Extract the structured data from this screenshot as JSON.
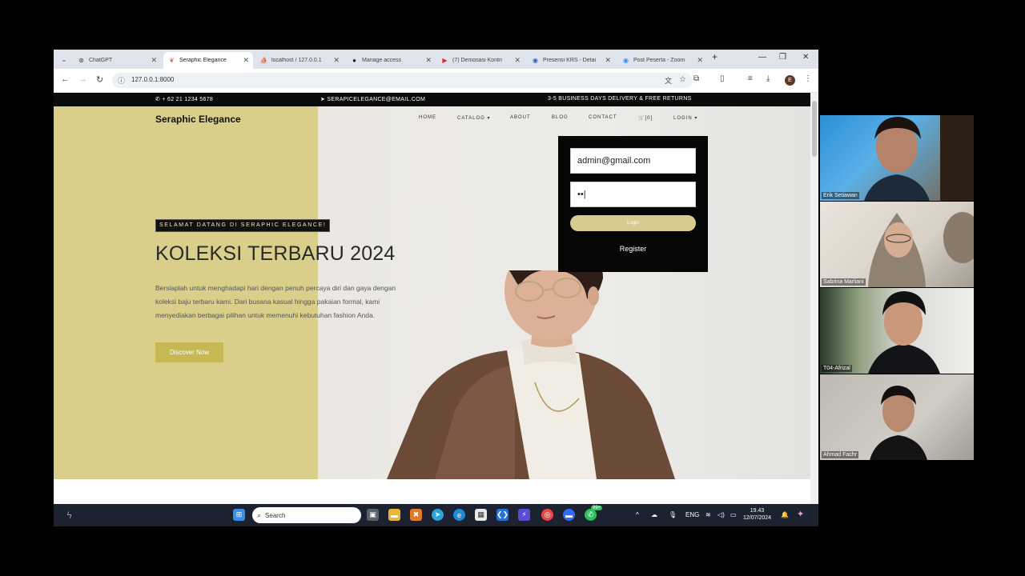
{
  "browser": {
    "tabs": [
      {
        "label": "ChatGPT",
        "icon": "chatgpt-icon",
        "close": "✕"
      },
      {
        "label": "Seraphic Elegance",
        "icon": "site-icon",
        "close": "✕",
        "active": true
      },
      {
        "label": "localhost / 127.0.0.1",
        "icon": "phpmyadmin-icon",
        "close": "✕"
      },
      {
        "label": "Manage access",
        "icon": "github-icon",
        "close": "✕"
      },
      {
        "label": "(7) Demosasi Kontri",
        "icon": "youtube-icon",
        "close": "✕"
      },
      {
        "label": "Presensi KRS - Detai",
        "icon": "krs-icon",
        "close": "✕"
      },
      {
        "label": "Post Peserta - Zoom",
        "icon": "zoom-icon",
        "close": "✕"
      }
    ],
    "new_tab": "+",
    "window_controls": {
      "minimize": "—",
      "restore": "❐",
      "close": "✕"
    },
    "url": "127.0.0.1:8000",
    "profile_initial": "E"
  },
  "site": {
    "topbar": {
      "phone": "+ 62 21 1234 5678",
      "email": "SERAPICELEGANCE@EMAIL.COM",
      "delivery": "3-5 BUSINESS DAYS DELIVERY & FREE RETURNS"
    },
    "brand": "Seraphic Elegance",
    "nav": {
      "home": "HOME",
      "catalog": "CATALOG ▾",
      "about": "ABOUT",
      "blog": "BLOG",
      "contact": "CONTACT",
      "cart": "🛒[0]",
      "login": "LOGIN ▾"
    },
    "hero": {
      "badge": "SELAMAT DATANG DI SERAPHIC ELEGANCE!",
      "title": "KOLEKSI TERBARU 2024",
      "description": "Bersiaplah untuk menghadapi hari dengan penuh percaya diri dan gaya dengan koleksi baju terbaru kami. Dari busana kasual hingga pakaian formal, kami menyediakan berbagai pilihan untuk memenuhi kebutuhan fashion Anda.",
      "cta": "Discover Now"
    },
    "login_form": {
      "email_value": "admin@gmail.com",
      "password_value": "••|",
      "submit": "Login",
      "register": "Register"
    }
  },
  "taskbar": {
    "search_placeholder": "Search",
    "language": "ENG",
    "time": "19.43",
    "date": "12/07/2024",
    "whatsapp_badge": "99+"
  },
  "participants": [
    {
      "name": "Erik Setiawan"
    },
    {
      "name": "Sabrina Marliani"
    },
    {
      "name": "T04-Afrizal"
    },
    {
      "name": "Ahmad Fachr"
    }
  ],
  "colors": {
    "hero_left": "#d9cf8a",
    "cta": "#c6b853",
    "login_button": "#d7cb8f"
  }
}
